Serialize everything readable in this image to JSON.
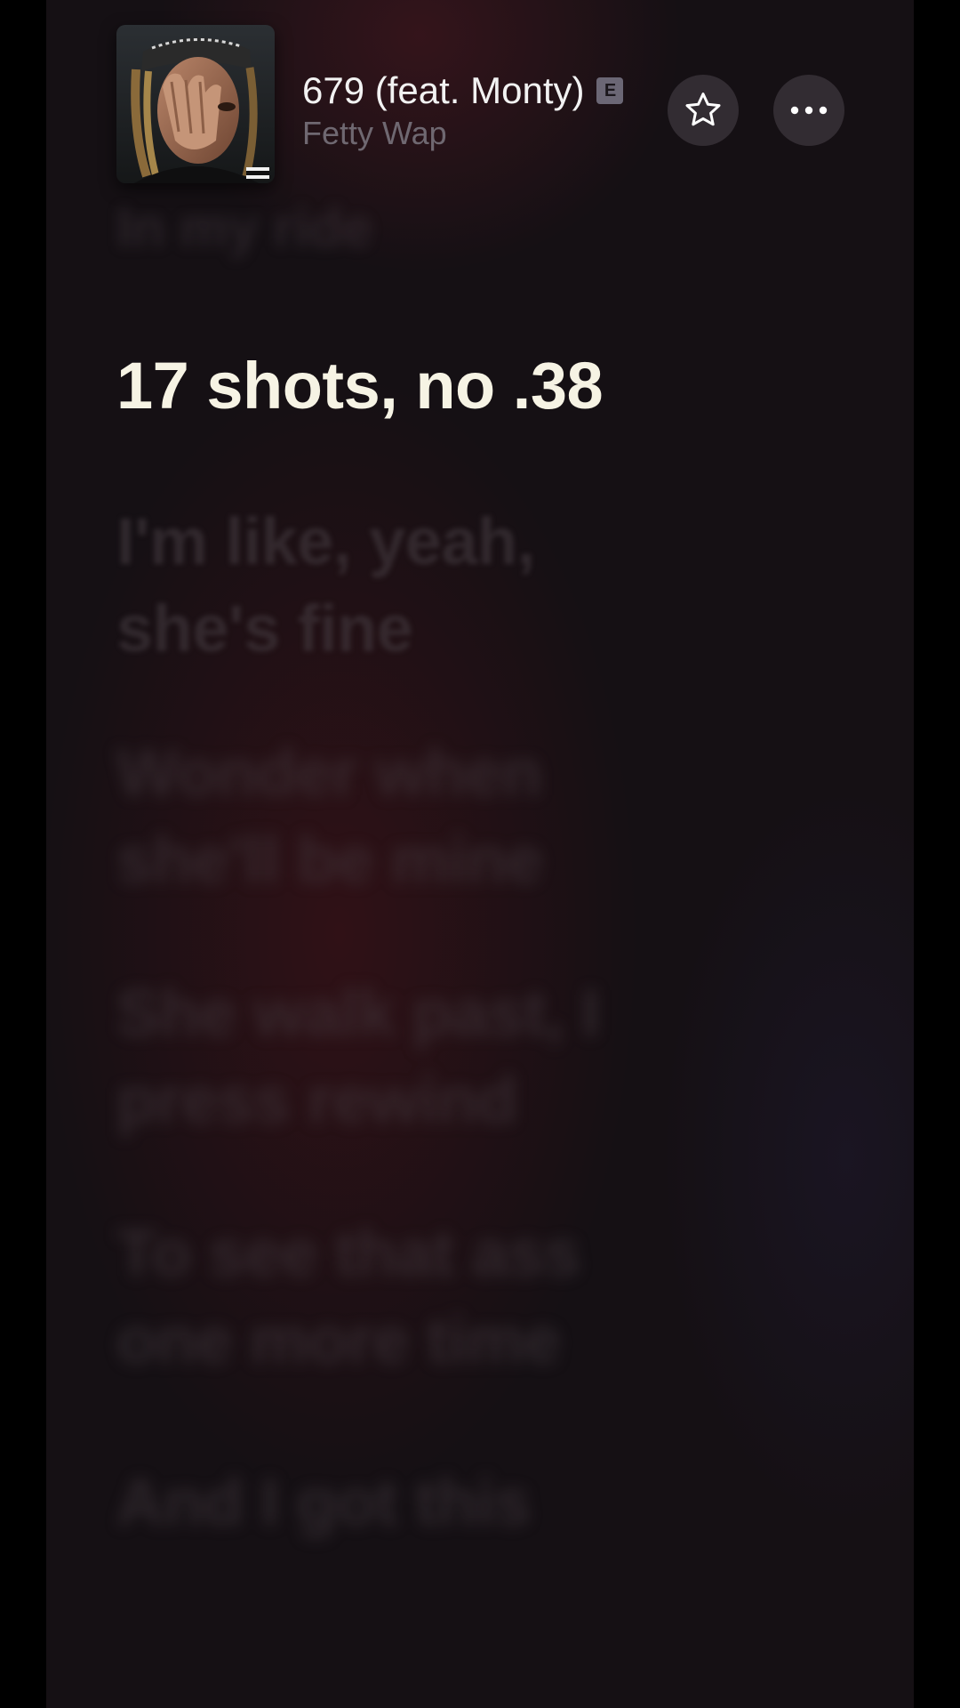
{
  "track": {
    "title": "679 (feat. Monty)",
    "explicit_badge": "E",
    "artist": "Fetty Wap",
    "artwork_icon": "album-artwork"
  },
  "actions": {
    "favorite_icon": "star-outline-icon",
    "more_icon": "ellipsis-icon"
  },
  "lyrics": {
    "previous_line": "In my ride",
    "current_line": "17 shots, no .38",
    "upcoming": [
      "I'm like, yeah, she's fine",
      "Wonder when she'll be mine",
      "She walk past, I press rewind",
      "To see that ass one more time",
      "And I got this"
    ]
  },
  "colors": {
    "current_lyric": "#f6f3e4",
    "dim_lyric": "#463c42",
    "background": "#151014"
  }
}
